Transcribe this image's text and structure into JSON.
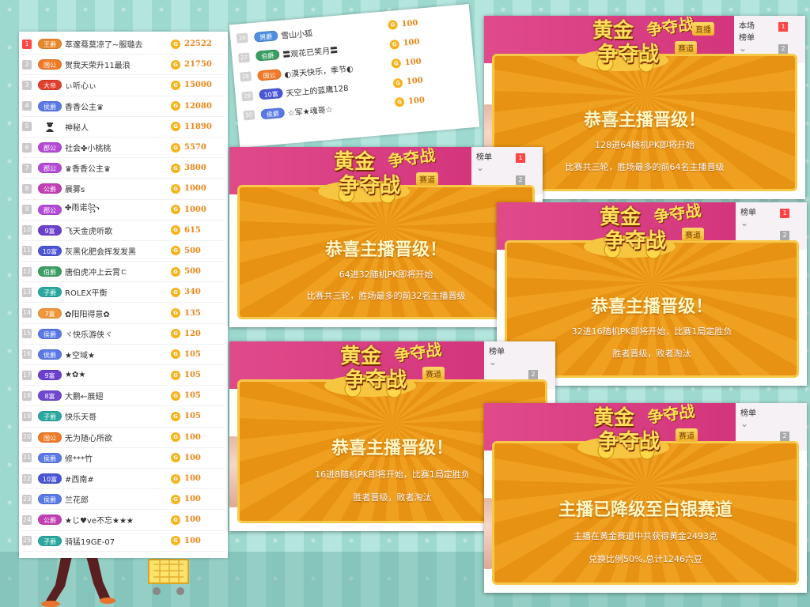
{
  "rank_list": [
    {
      "rank": "1",
      "badge": "王爵",
      "badge_color": "#e8862b",
      "name": "萃邃蓦莫凉了~服璐去",
      "score": "22522"
    },
    {
      "rank": "2",
      "badge": "国公",
      "badge_color": "#f07a26",
      "name": "贺我天荣升11最浪",
      "score": "21750"
    },
    {
      "rank": "3",
      "badge": "大帝",
      "badge_color": "#e23f2d",
      "name": "ぃ听心ぃ",
      "score": "15000"
    },
    {
      "rank": "4",
      "badge": "侯爵",
      "badge_color": "#5a79e6",
      "name": "香香公主♛",
      "score": "12080"
    },
    {
      "rank": "5",
      "badge": "",
      "badge_color": "#ffffff",
      "name": "神秘人",
      "score": "11890"
    },
    {
      "rank": "6",
      "badge": "郡公",
      "badge_color": "#b44bd6",
      "name": "社会✤小桃桃",
      "score": "5570"
    },
    {
      "rank": "7",
      "badge": "郡公",
      "badge_color": "#b44bd6",
      "name": "♛香香公主♛",
      "score": "3800"
    },
    {
      "rank": "8",
      "badge": "公爵",
      "badge_color": "#c33fb4",
      "name": "晨雾s",
      "score": "1000"
    },
    {
      "rank": "9",
      "badge": "郡公",
      "badge_color": "#b44bd6",
      "name": "✤雨诺꧂",
      "score": "1000"
    },
    {
      "rank": "10",
      "badge": "9富",
      "badge_color": "#6b3fcf",
      "name": "飞天金虎听歌",
      "score": "615"
    },
    {
      "rank": "11",
      "badge": "10富",
      "badge_color": "#4b56d6",
      "name": "灰黑化肥会挥发发黑",
      "score": "500"
    },
    {
      "rank": "12",
      "badge": "伯爵",
      "badge_color": "#3b9e62",
      "name": "唐伯虎冲上云霄ㄷ",
      "score": "500"
    },
    {
      "rank": "13",
      "badge": "子爵",
      "badge_color": "#2aa8a0",
      "name": "ROLEX平衡",
      "score": "340"
    },
    {
      "rank": "14",
      "badge": "7富",
      "badge_color": "#f0973a",
      "name": "✿阳阳得意✿",
      "score": "135"
    },
    {
      "rank": "15",
      "badge": "侯爵",
      "badge_color": "#5a79e6",
      "name": "ヾ快乐游侠ヾ",
      "score": "120"
    },
    {
      "rank": "16",
      "badge": "侯爵",
      "badge_color": "#5a79e6",
      "name": "★空域★",
      "score": "105"
    },
    {
      "rank": "17",
      "badge": "9富",
      "badge_color": "#6b3fcf",
      "name": "★✿★",
      "score": "105"
    },
    {
      "rank": "18",
      "badge": "8富",
      "badge_color": "#7048d0",
      "name": "大鹏←展翅",
      "score": "105"
    },
    {
      "rank": "19",
      "badge": "子爵",
      "badge_color": "#2aa8a0",
      "name": "快乐天哥",
      "score": "105"
    },
    {
      "rank": "20",
      "badge": "国公",
      "badge_color": "#f07a26",
      "name": "无为随心所欲",
      "score": "100"
    },
    {
      "rank": "21",
      "badge": "侯爵",
      "badge_color": "#5a79e6",
      "name": "修***竹",
      "score": "100"
    },
    {
      "rank": "22",
      "badge": "10富",
      "badge_color": "#4b56d6",
      "name": "#西南#",
      "score": "100"
    },
    {
      "rank": "23",
      "badge": "侯爵",
      "badge_color": "#5a79e6",
      "name": "兰花郎",
      "score": "100"
    },
    {
      "rank": "24",
      "badge": "公爵",
      "badge_color": "#c33fb4",
      "name": "★じ♥ve不忘★★★",
      "score": "100"
    },
    {
      "rank": "25",
      "badge": "子爵",
      "badge_color": "#2aa8a0",
      "name": "骑猛19GE-07",
      "score": "100"
    }
  ],
  "small_list": [
    {
      "rank": "26",
      "badge": "男爵",
      "badge_color": "#4d8fe0",
      "name": "雪山小狐",
      "score": "100"
    },
    {
      "rank": "27",
      "badge": "伯爵",
      "badge_color": "#3b9e62",
      "name": "〓观花已笑月〓",
      "score": "100"
    },
    {
      "rank": "28",
      "badge": "国公",
      "badge_color": "#f07a26",
      "name": "◐漠天快乐，季节◐",
      "score": "100"
    },
    {
      "rank": "29",
      "badge": "10富",
      "badge_color": "#4b56d6",
      "name": "天空上的蓝鹰128",
      "score": "100"
    },
    {
      "rank": "30",
      "badge": "侯爵",
      "badge_color": "#5a79e6",
      "name": "☆军★魂哥☆",
      "score": "100"
    }
  ],
  "coin_glyph": "G",
  "logo": {
    "line1": "黄金",
    "line2": "争夺战",
    "road": "赛道",
    "host_tag": "直播"
  },
  "tab": {
    "board": "榜单",
    "this_round": "本场",
    "badge_1": "1",
    "badge_2": "2"
  },
  "popups": [
    {
      "title": "恭喜主播晋级！",
      "line1": "128进64随机PK即将开始",
      "line2": "比赛共三轮，胜场最多的前64名主播晋级"
    },
    {
      "title": "恭喜主播晋级！",
      "line1": "64进32随机PK即将开始",
      "line2": "比赛共三轮，胜场最多的前32名主播晋级"
    },
    {
      "title": "恭喜主播晋级！",
      "line1": "32进16随机PK即将开始，比赛1局定胜负",
      "line2": "胜者晋级，败者淘汰"
    },
    {
      "title": "恭喜主播晋级！",
      "line1": "16进8随机PK即将开始，比赛1局定胜负",
      "line2": "胜者晋级，败者淘汰"
    },
    {
      "title": "主播已降级至白银赛道",
      "line1": "主播在黄金赛道中共获得黄金2493克",
      "line2": "兑换比例50%,总计1246六豆"
    }
  ],
  "colors": {
    "gold": "#f0a020",
    "pink": "#d93a83",
    "title_yellow": "#fff8c5",
    "score_orange": "#e8861a"
  }
}
